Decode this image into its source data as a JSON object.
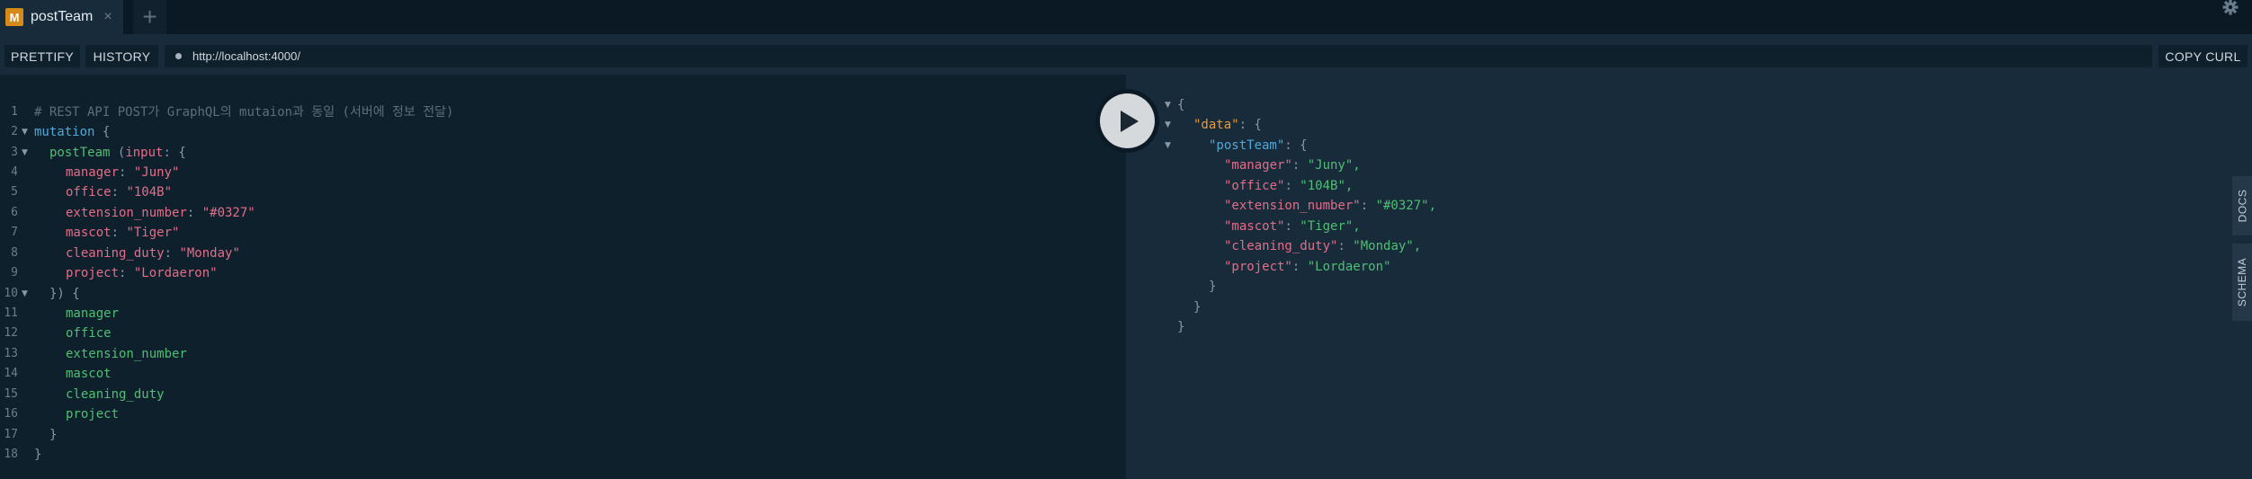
{
  "tabs": [
    {
      "badge": "M",
      "title": "postTeam",
      "close": "×"
    }
  ],
  "tab_add": "+",
  "toolbar": {
    "prettify": "PRETTIFY",
    "history": "HISTORY",
    "url": "http://localhost:4000/",
    "copy_curl": "COPY CURL"
  },
  "side_tabs": {
    "docs": "DOCS",
    "schema": "SCHEMA"
  },
  "query_lines": [
    {
      "n": "1",
      "text": "# REST API POST가 GraphQL의 mutaion과 동일 (서버에 정보 전달)"
    },
    {
      "n": "2",
      "text": "mutation {"
    },
    {
      "n": "3",
      "text": "postTeam (input: {"
    },
    {
      "n": "4",
      "text": "manager: \"Juny\""
    },
    {
      "n": "5",
      "text": "office: \"104B\""
    },
    {
      "n": "6",
      "text": "extension_number: \"#0327\""
    },
    {
      "n": "7",
      "text": "mascot: \"Tiger\""
    },
    {
      "n": "8",
      "text": "cleaning_duty: \"Monday\""
    },
    {
      "n": "9",
      "text": "project: \"Lordaeron\""
    },
    {
      "n": "10",
      "text": "}) {"
    },
    {
      "n": "11",
      "text": "manager"
    },
    {
      "n": "12",
      "text": "office"
    },
    {
      "n": "13",
      "text": "extension_number"
    },
    {
      "n": "14",
      "text": "mascot"
    },
    {
      "n": "15",
      "text": "cleaning_duty"
    },
    {
      "n": "16",
      "text": "project"
    },
    {
      "n": "17",
      "text": "}"
    },
    {
      "n": "18",
      "text": "}"
    }
  ],
  "query_parts": {
    "comment": "# REST API POST가 GraphQL의 mutaion과 동일 (서버에 정보 전달)",
    "mutation_kw": "mutation",
    "brace_open": "{",
    "brace_close": "}",
    "postTeam": "postTeam",
    "paren_input": "(",
    "input_kw": "input",
    "colon_brace": ": {",
    "close_args": "}) {",
    "args": [
      {
        "key": "manager",
        "value": "\"Juny\""
      },
      {
        "key": "office",
        "value": "\"104B\""
      },
      {
        "key": "extension_number",
        "value": "\"#0327\""
      },
      {
        "key": "mascot",
        "value": "\"Tiger\""
      },
      {
        "key": "cleaning_duty",
        "value": "\"Monday\""
      },
      {
        "key": "project",
        "value": "\"Lordaeron\""
      }
    ],
    "fields": [
      "manager",
      "office",
      "extension_number",
      "mascot",
      "cleaning_duty",
      "project"
    ]
  },
  "result": {
    "open": "{",
    "data_key": "\"data\"",
    "team_key": "\"postTeam\"",
    "colon_brace": ": {",
    "entries": [
      {
        "key": "\"manager\"",
        "value": "\"Juny\","
      },
      {
        "key": "\"office\"",
        "value": "\"104B\","
      },
      {
        "key": "\"extension_number\"",
        "value": "\"#0327\","
      },
      {
        "key": "\"mascot\"",
        "value": "\"Tiger\","
      },
      {
        "key": "\"cleaning_duty\"",
        "value": "\"Monday\","
      },
      {
        "key": "\"project\"",
        "value": "\"Lordaeron\""
      }
    ],
    "close": "}",
    "colon": ": "
  },
  "colors": {
    "background": "#0f202d",
    "toolbar": "#172b3a",
    "tab_badge": "#d58a1a",
    "keyword": "#4fa8d8",
    "string": "#e36d88",
    "field": "#4fbf73"
  }
}
